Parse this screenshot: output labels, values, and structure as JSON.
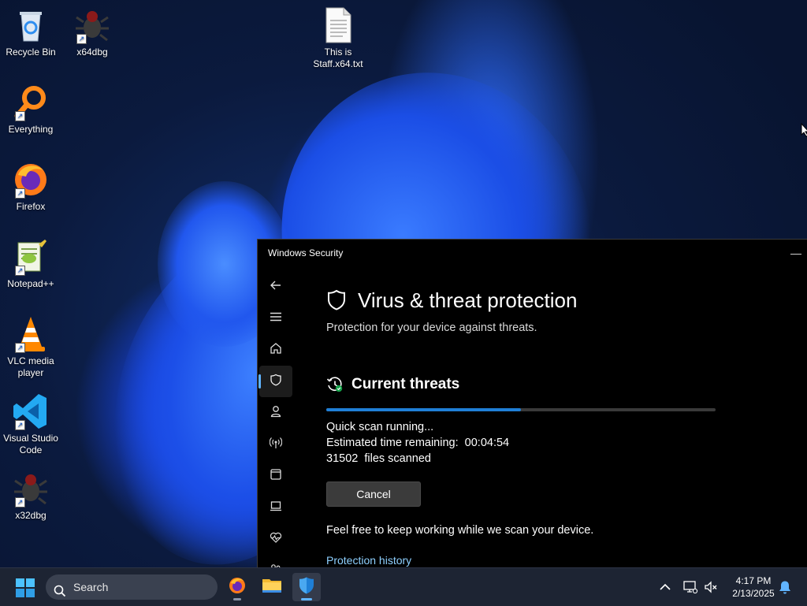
{
  "desktop": {
    "icons": [
      {
        "label": "Recycle Bin",
        "icon": "recycle-bin-icon"
      },
      {
        "label": "x64dbg",
        "icon": "bug-icon"
      },
      {
        "label": "This is Staff.x64.txt",
        "icon": "text-file-icon"
      },
      {
        "label": "Everything",
        "icon": "magnifier-icon"
      },
      {
        "label": "Firefox",
        "icon": "firefox-icon"
      },
      {
        "label": "Notepad++",
        "icon": "notepad-plus-plus-icon"
      },
      {
        "label": "VLC media player",
        "icon": "vlc-cone-icon"
      },
      {
        "label": "Visual Studio Code",
        "icon": "vscode-icon"
      },
      {
        "label": "x32dbg",
        "icon": "bug-icon"
      }
    ]
  },
  "window": {
    "title": "Windows Security",
    "minimize_label": "—"
  },
  "nav": {
    "items": [
      {
        "icon": "back-arrow-icon"
      },
      {
        "icon": "hamburger-menu-icon"
      },
      {
        "icon": "home-icon"
      },
      {
        "icon": "shield-icon",
        "active": true
      },
      {
        "icon": "account-icon"
      },
      {
        "icon": "network-antenna-icon"
      },
      {
        "icon": "app-browser-icon"
      },
      {
        "icon": "laptop-icon"
      },
      {
        "icon": "heart-pulse-icon"
      },
      {
        "icon": "family-icon"
      }
    ]
  },
  "page": {
    "title": "Virus & threat protection",
    "subtitle": "Protection for your device against threats."
  },
  "threats": {
    "section_title": "Current threats",
    "progress_fraction": 0.5,
    "scan_status": "Quick scan running...",
    "time_remaining_label": "Estimated time remaining:",
    "time_remaining_value": "00:04:54",
    "files_scanned_count": "31502",
    "files_scanned_label": "files scanned",
    "cancel_label": "Cancel",
    "info_text": "Feel free to keep working while we scan your device.",
    "history_link": "Protection history"
  },
  "taskbar": {
    "search_placeholder": "Search",
    "apps": [
      "firefox-icon",
      "file-explorer-icon",
      "windows-security-icon"
    ],
    "clock_time": "4:17 PM",
    "clock_date": "2/13/2025"
  },
  "colors": {
    "accent": "#1f7fd6",
    "link": "#8ed0ff",
    "window_bg": "#000000",
    "taskbar_bg": "#1d2433"
  }
}
